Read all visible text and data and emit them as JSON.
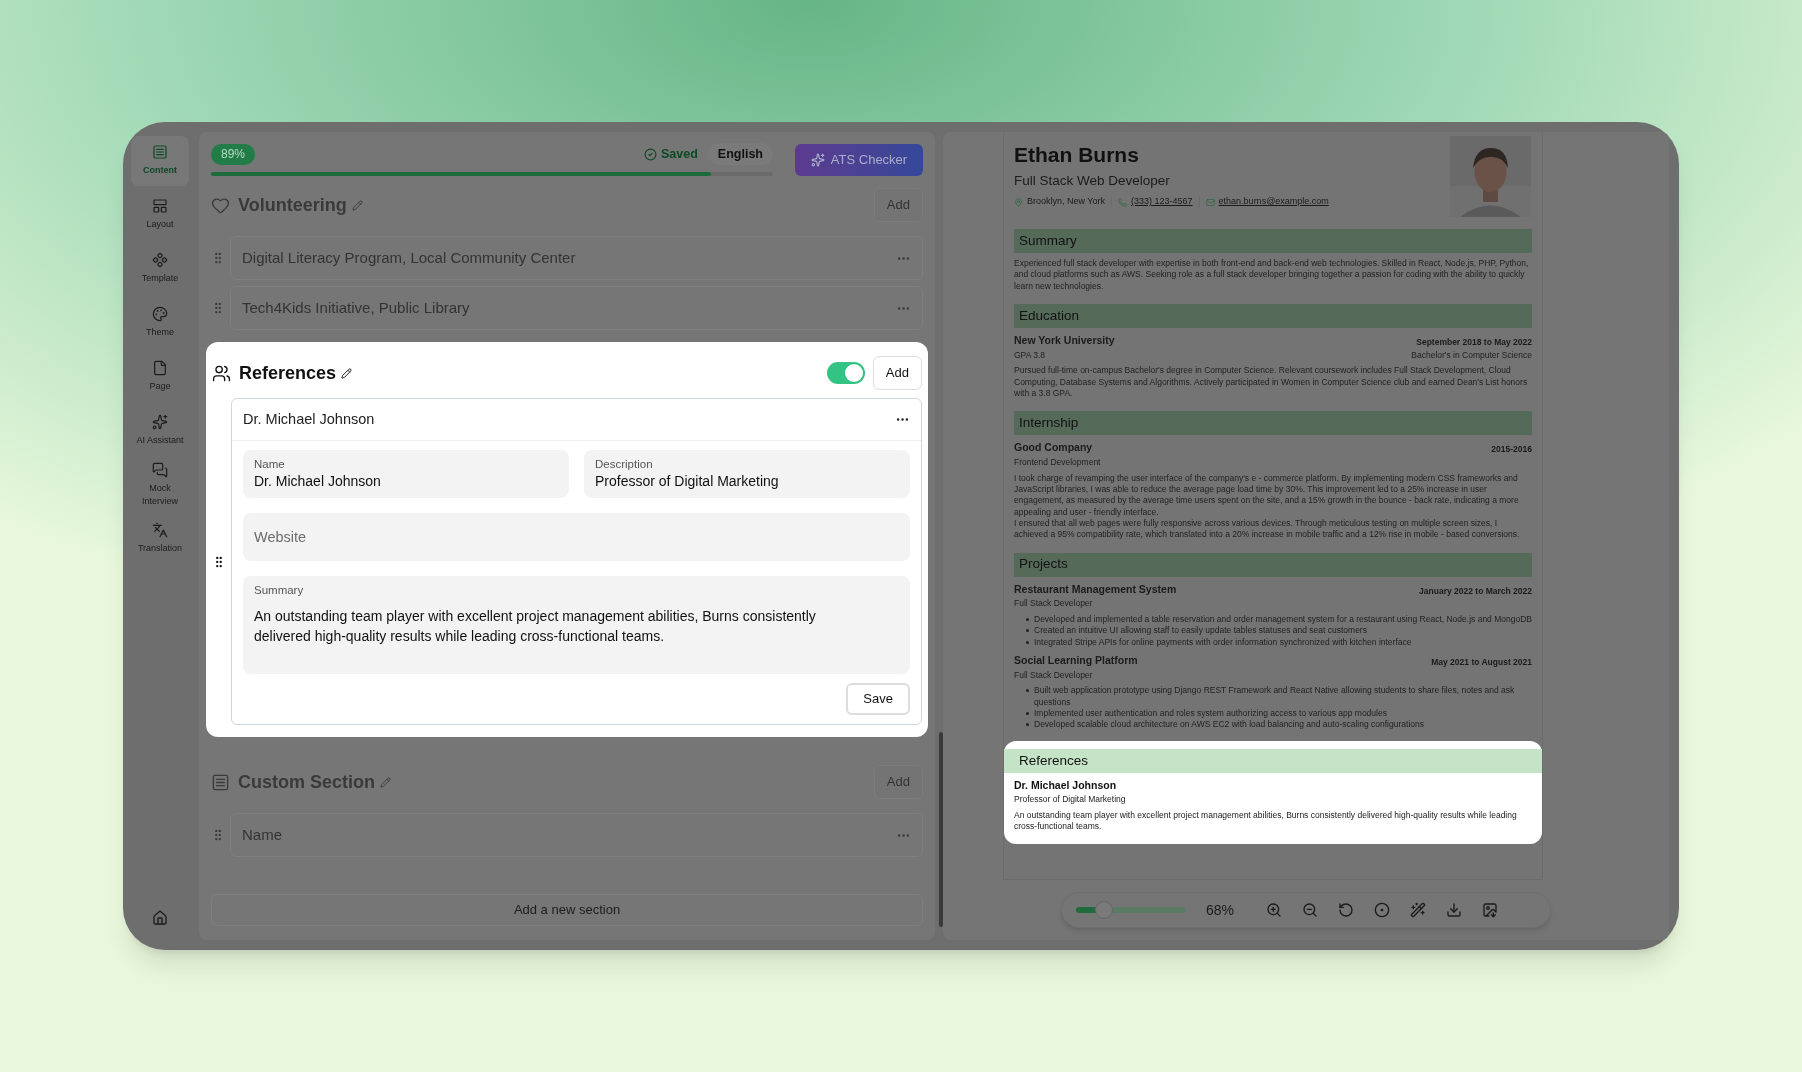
{
  "sidebar": {
    "items": [
      {
        "label": "Content",
        "selected": true
      },
      {
        "label": "Layout",
        "selected": false
      },
      {
        "label": "Template",
        "selected": false
      },
      {
        "label": "Theme",
        "selected": false
      },
      {
        "label": "Page",
        "selected": false
      },
      {
        "label": "AI Assistant",
        "selected": false
      },
      {
        "label": "Mock Interview",
        "selected": false
      },
      {
        "label": "Translation",
        "selected": false
      }
    ]
  },
  "editor": {
    "progress": {
      "text": "89%",
      "level": 0.89
    },
    "save_status": "Saved",
    "language": "English",
    "ats_button": "ATS Checker",
    "sections": [
      {
        "kind": "list",
        "title": "Volunteering",
        "add": "Add",
        "highlighted": false,
        "items": [
          "Digital Literacy Program, Local Community Center",
          "Tech4Kids Initiative, Public Library"
        ]
      },
      {
        "kind": "form",
        "title": "References",
        "add": "Add",
        "highlighted": true,
        "visible": {
          "on": true
        },
        "entry": {
          "title": "Dr. Michael Johnson",
          "fields": [
            {
              "label": "Name",
              "value": "Dr. Michael Johnson"
            },
            {
              "label": "Description",
              "value": "Professor of Digital Marketing"
            },
            {
              "placeholder": "Website"
            },
            {
              "label": "Summary",
              "value": "An outstanding team player with excellent project management abilities, Burns consistently delivered high-quality results while leading cross-functional teams."
            }
          ],
          "save": "Save"
        }
      },
      {
        "kind": "list",
        "title": "Custom Section",
        "add": "Add",
        "highlighted": false,
        "items": [
          "Name"
        ]
      }
    ],
    "add_section": "Add a new section"
  },
  "resume": {
    "name": "Ethan Burns",
    "headline": "Full Stack Web Developer",
    "contacts": [
      {
        "kind": "location",
        "text": "Brooklyn, New York",
        "link": false
      },
      {
        "kind": "phone",
        "text": "(333) 123-4567",
        "link": true
      },
      {
        "kind": "email",
        "text": "ethan.burns@example.com",
        "link": true
      }
    ],
    "sections": [
      {
        "title": "Summary",
        "highlighted": false,
        "text": "Experienced full stack developer with expertise in both front-end and back-end web technologies. Skilled in React, Node.js, PHP, Python, and cloud platforms such as AWS. Seeking role as a full stack developer bringing together a passion for coding with the ability to quickly learn new technologies."
      },
      {
        "title": "Education",
        "highlighted": false,
        "entries": [
          {
            "title": "New York University",
            "subtitle": "GPA 3.8",
            "date": "September 2018 to May 2022",
            "date_sub": "Bachelor's in Computer Science",
            "paragraphs": [
              "Pursued full-time on-campus Bachelor's degree in Computer Science. Relevant coursework includes Full Stack Development, Cloud Computing, Database Systems and Algorithms. Actively participated in Women in Computer Science club and earned Dean's List honors with a 3.8 GPA."
            ]
          }
        ]
      },
      {
        "title": "Internship",
        "highlighted": false,
        "entries": [
          {
            "title": "Good Company",
            "subtitle": "Frontend Development",
            "date": "2015-2016",
            "paragraphs": [
              "I took charge of revamping the user interface of the company's e - commerce platform. By implementing modern CSS frameworks and JavaScript libraries, I was able to reduce the average page load time by 30%. This improvement led to a 25% increase in user engagement, as measured by the average time users spent on the site, and a 15% growth in the bounce - back rate, indicating a more appealing and user - friendly interface.",
              "I ensured that all web pages were fully responsive across various devices. Through meticulous testing on multiple screen sizes, I achieved a 95% compatibility rate, which translated into a 20% increase in mobile traffic and a 12% rise in mobile - based conversions."
            ]
          }
        ]
      },
      {
        "title": "Projects",
        "highlighted": false,
        "entries": [
          {
            "title": "Restaurant Management System",
            "subtitle": "Full Stack Developer",
            "date": "January 2022 to March 2022",
            "bullets": [
              "Developed and implemented a table reservation and order management system for a restaurant using React, Node.js and MongoDB",
              "Created an intuitive UI allowing staff to easily update tables statuses and seat customers",
              "Integrated Stripe APIs for online payments with order information synchronized with kitchen interface"
            ]
          },
          {
            "title": "Social Learning Platform",
            "subtitle": "Full Stack Developer",
            "date": "May 2021 to August 2021",
            "bullets": [
              "Built web application prototype using Django REST Framework and React Native allowing students to share files, notes and ask questions",
              "Implemented user authentication and roles system authorizing access to various app modules",
              "Developed scalable cloud architecture on AWS EC2 with load balancing and auto-scaling configurations"
            ]
          }
        ]
      },
      {
        "title": "References",
        "highlighted": true,
        "entries": [
          {
            "title": "Dr. Michael Johnson",
            "subtitle": "Professor of Digital Marketing",
            "paragraphs": [
              "An outstanding team player with excellent project management abilities, Burns consistently delivered high-quality results while leading cross-functional teams."
            ]
          }
        ]
      }
    ]
  },
  "zoom": {
    "level": 0.25,
    "text": "68%"
  }
}
